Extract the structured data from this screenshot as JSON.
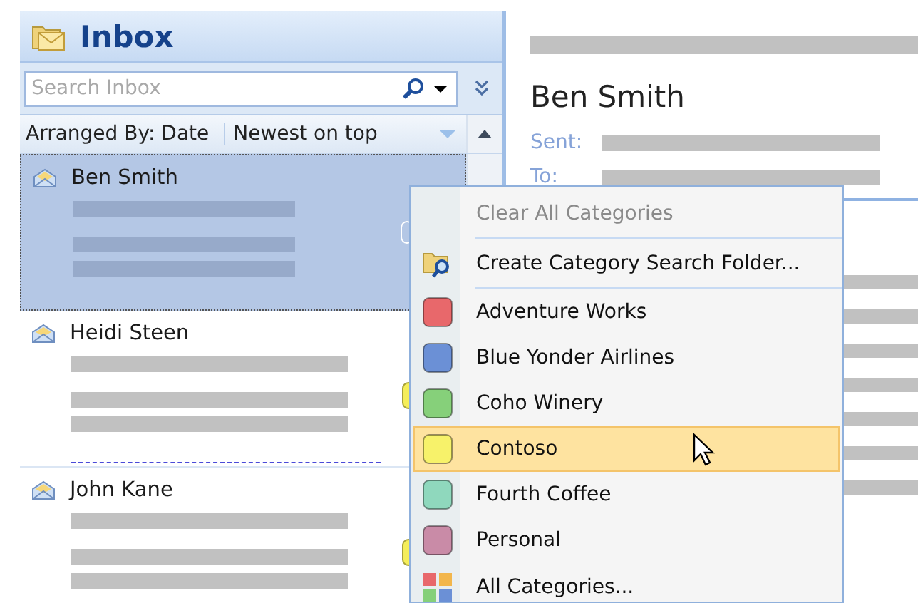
{
  "inbox": {
    "title": "Inbox",
    "search": {
      "placeholder": "Search Inbox"
    },
    "arranged_by": "Arranged By: Date",
    "sort_order": "Newest on top"
  },
  "messages": [
    {
      "sender": "Ben Smith",
      "selected": true,
      "color": "#ffffff"
    },
    {
      "sender": "Heidi Steen",
      "selected": false,
      "color": "#f5ee5a"
    },
    {
      "sender": "John Kane",
      "selected": false,
      "color": "#f5ee5a"
    }
  ],
  "reading_pane": {
    "sender": "Ben Smith",
    "fields": [
      "Sent:",
      "To:"
    ]
  },
  "menu": {
    "items": [
      {
        "kind": "clear",
        "label": "Clear All Categories",
        "disabled": true,
        "highlighted": false,
        "separator_after": true
      },
      {
        "kind": "search_folder",
        "label": "Create Category Search Folder...",
        "disabled": false,
        "highlighted": false,
        "separator_after": true
      },
      {
        "kind": "category",
        "label": "Adventure Works",
        "color": "#e8686b",
        "disabled": false,
        "highlighted": false,
        "separator_after": false
      },
      {
        "kind": "category",
        "label": "Blue Yonder Airlines",
        "color": "#6b90d6",
        "disabled": false,
        "highlighted": false,
        "separator_after": false
      },
      {
        "kind": "category",
        "label": "Coho Winery",
        "color": "#86d07a",
        "disabled": false,
        "highlighted": false,
        "separator_after": false
      },
      {
        "kind": "category",
        "label": "Contoso",
        "color": "#f7f26a",
        "disabled": false,
        "highlighted": true,
        "separator_after": false
      },
      {
        "kind": "category",
        "label": "Fourth Coffee",
        "color": "#8fd8bd",
        "disabled": false,
        "highlighted": false,
        "separator_after": false
      },
      {
        "kind": "category",
        "label": "Personal",
        "color": "#c98ba7",
        "disabled": false,
        "highlighted": false,
        "separator_after": false
      },
      {
        "kind": "all_categories",
        "label": "All Categories...",
        "disabled": false,
        "highlighted": false,
        "separator_after": false
      }
    ]
  }
}
